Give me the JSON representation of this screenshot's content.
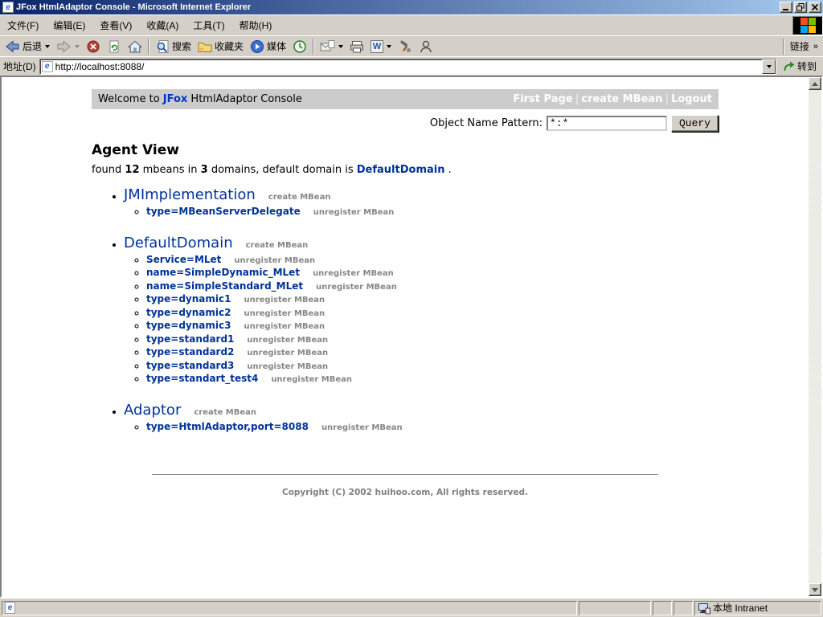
{
  "window": {
    "title": "JFox HtmlAdaptor Console - Microsoft Internet Explorer",
    "menu_items": [
      "文件(F)",
      "编辑(E)",
      "查看(V)",
      "收藏(A)",
      "工具(T)",
      "帮助(H)"
    ],
    "toolbar": {
      "back_label": "后退",
      "search_label": "搜索",
      "favorites_label": "收藏夹",
      "media_label": "媒体",
      "links_label": "链接",
      "links_chevron": "»",
      "edit_word_glyph": "W"
    },
    "address_bar": {
      "label": "地址(D)",
      "value": "http://localhost:8088/",
      "go_label": "转到"
    },
    "status_bar": {
      "zone_label": "本地 Intranet"
    }
  },
  "page": {
    "header": {
      "welcome_prefix": "Welcome to ",
      "brand": "JFox",
      "welcome_suffix": " HtmlAdaptor Console",
      "nav_separator": "|",
      "nav": [
        {
          "label": "First Page"
        },
        {
          "label": "create MBean"
        },
        {
          "label": "Logout"
        }
      ]
    },
    "query": {
      "label": "Object Name Pattern:",
      "value": "*:*",
      "button_label": "Query"
    },
    "heading": "Agent View",
    "summary": {
      "part1": "found ",
      "mbean_count": "12",
      "part2": " mbeans in ",
      "domain_count": "3",
      "part3": " domains, default domain is ",
      "default_domain": "DefaultDomain",
      "part4": " ."
    },
    "create_action": "create MBean",
    "unregister_action": "unregister MBean",
    "domains": [
      {
        "name": "JMImplementation",
        "mbeans": [
          "type=MBeanServerDelegate"
        ]
      },
      {
        "name": "DefaultDomain",
        "mbeans": [
          "Service=MLet",
          "name=SimpleDynamic_MLet",
          "name=SimpleStandard_MLet",
          "type=dynamic1",
          "type=dynamic2",
          "type=dynamic3",
          "type=standard1",
          "type=standard2",
          "type=standard3",
          "type=standart_test4"
        ]
      },
      {
        "name": "Adaptor",
        "mbeans": [
          "type=HtmlAdaptor,port=8088"
        ]
      }
    ],
    "footer": "Copyright (C) 2002 huihoo.com, All rights reserved."
  },
  "colors": {
    "titlebar_left": "#0a246a",
    "titlebar_right": "#a6caf0",
    "chrome_gray": "#d4d0c8",
    "page_header_bg": "#cccccc",
    "brand_blue": "#0033cc",
    "link_blue": "#003399",
    "action_gray": "#878787"
  }
}
